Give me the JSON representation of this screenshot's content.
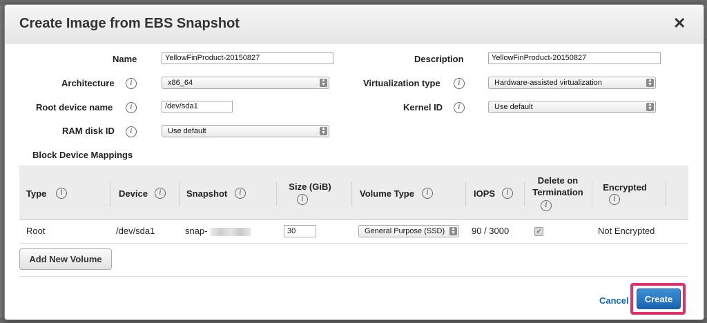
{
  "dialog": {
    "title": "Create Image from EBS Snapshot",
    "close": "✕"
  },
  "form": {
    "name_label": "Name",
    "name_value": "YellowFinProduct-20150827",
    "description_label": "Description",
    "description_value": "YellowFinProduct-20150827",
    "architecture_label": "Architecture",
    "architecture_value": "x86_64",
    "virtualization_label": "Virtualization type",
    "virtualization_value": "Hardware-assisted virtualization",
    "root_device_label": "Root device name",
    "root_device_value": "/dev/sda1",
    "kernel_label": "Kernel ID",
    "kernel_value": "Use default",
    "ramdisk_label": "RAM disk ID",
    "ramdisk_value": "Use default"
  },
  "info_glyph": "i",
  "block_device": {
    "title": "Block Device Mappings",
    "columns": {
      "type": "Type",
      "device": "Device",
      "snapshot": "Snapshot",
      "size": "Size (GiB)",
      "volume_type": "Volume Type",
      "iops": "IOPS",
      "delete_line1": "Delete on",
      "delete_line2": "Termination",
      "encrypted": "Encrypted"
    },
    "row": {
      "type": "Root",
      "device": "/dev/sda1",
      "snapshot": "snap-",
      "size": "30",
      "volume_type": "General Purpose (SSD)",
      "iops": "90 / 3000",
      "delete_checked": "✓",
      "encrypted": "Not Encrypted"
    },
    "add_button": "Add New Volume"
  },
  "footer": {
    "cancel": "Cancel",
    "create": "Create"
  },
  "colors": {
    "accent": "#1b64b0",
    "highlight": "#e0306e",
    "link": "#1166bb"
  }
}
